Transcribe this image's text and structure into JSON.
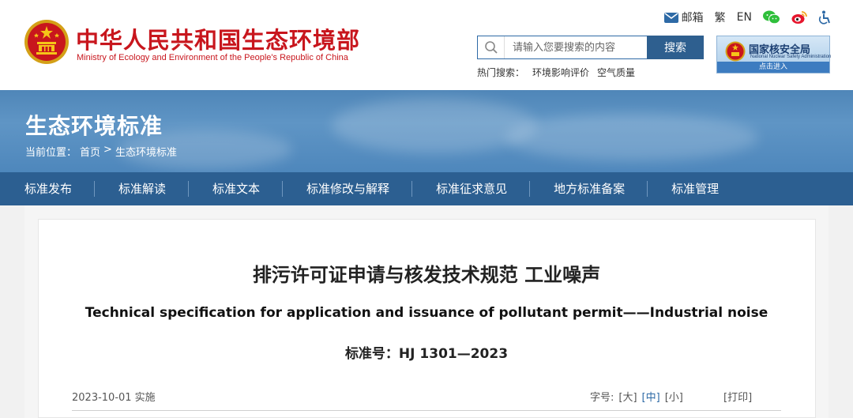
{
  "site": {
    "name_cn": "中华人民共和国生态环境部",
    "name_en": "Ministry of Ecology and Environment of the People's Republic of China"
  },
  "toplinks": {
    "mail": "邮箱",
    "traditional": "繁",
    "english": "EN"
  },
  "search": {
    "placeholder": "请输入您要搜索的内容",
    "button": "搜索",
    "hot_label": "热门搜索：",
    "hot_items": [
      "环境影响评价",
      "空气质量"
    ]
  },
  "nnsa": {
    "title": "国家核安全局",
    "subtitle": "National Nuclear Safety Administration",
    "enter": "点击进入"
  },
  "banner": {
    "title": "生态环境标准",
    "breadcrumb_label": "当前位置：",
    "breadcrumb_home": "首页",
    "breadcrumb_sep": ">",
    "breadcrumb_current": "生态环境标准"
  },
  "nav": [
    "标准发布",
    "标准解读",
    "标准文本",
    "标准修改与解释",
    "标准征求意见",
    "地方标准备案",
    "标准管理"
  ],
  "document": {
    "title_cn": "排污许可证申请与核发技术规范 工业噪声",
    "title_en": "Technical specification for application and issuance of pollutant permit——Industrial noise",
    "number": "标准号：HJ 1301—2023",
    "date": "2023-10-01 实施",
    "fontsize_label": "字号:",
    "fontsize_large": "[大]",
    "fontsize_medium": "[中]",
    "fontsize_small": "[小]",
    "print": "[打印]"
  },
  "colors": {
    "brand_red": "#c8161d",
    "nav_blue": "#2c5f91",
    "banner_blue": "#5f95c5",
    "active_link": "#2e6aa6"
  }
}
